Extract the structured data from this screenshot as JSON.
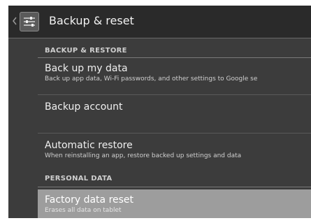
{
  "action_bar": {
    "title": "Backup & reset",
    "up_icon": "chevron-left-icon",
    "app_icon": "settings-sliders-icon"
  },
  "sections": {
    "backup_restore": "BACKUP & RESTORE",
    "personal_data": "PERSONAL DATA"
  },
  "items": {
    "backup_data": {
      "title": "Back up my data",
      "summary": "Back up app data, Wi-Fi passwords, and other settings to Google se"
    },
    "backup_account": {
      "title": "Backup account"
    },
    "auto_restore": {
      "title": "Automatic restore",
      "summary": "When reinstalling an app, restore backed up settings and data"
    },
    "factory_reset": {
      "title": "Factory data reset",
      "summary": "Erases all data on tablet"
    }
  },
  "colors": {
    "background": "#3c3c3c",
    "action_bar": "#2a2a2a",
    "highlight": "#9d9d9d"
  }
}
